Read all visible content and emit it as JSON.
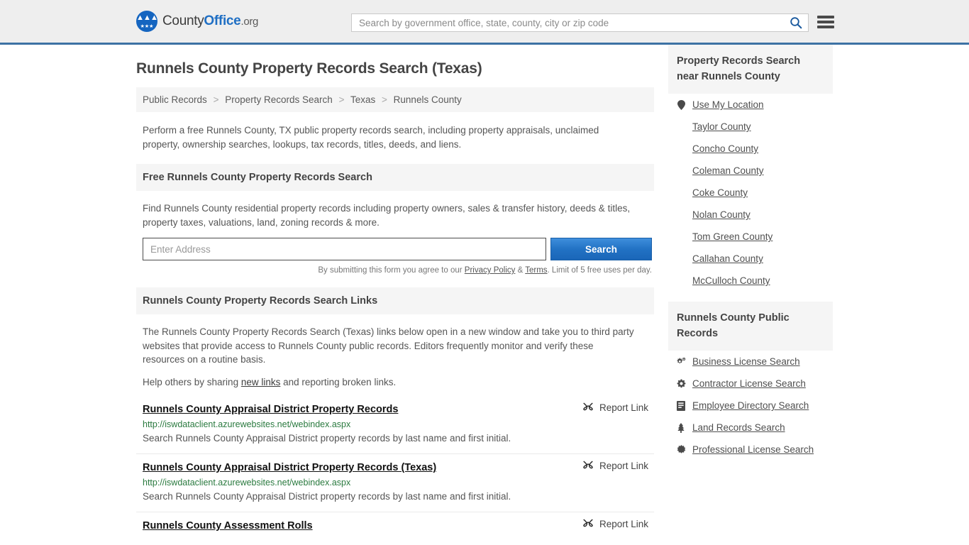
{
  "header": {
    "brand": {
      "part1": "County",
      "part2": "Office",
      "part3": ".org"
    },
    "search": {
      "placeholder": "Search by government office, state, county, city or zip code",
      "value": ""
    },
    "menu_label": "Menu"
  },
  "page_title": "Runnels County Property Records Search (Texas)",
  "breadcrumb": {
    "items": [
      "Public Records",
      "Property Records Search",
      "Texas",
      "Runnels County"
    ],
    "separator": ">"
  },
  "intro": "Perform a free Runnels County, TX public property records search, including property appraisals, unclaimed property, ownership searches, lookups, tax records, titles, deeds, and liens.",
  "free_search": {
    "heading": "Free Runnels County Property Records Search",
    "description": "Find Runnels County residential property records including property owners, sales & transfer history, deeds & titles, property taxes, valuations, land, zoning records & more.",
    "input_placeholder": "Enter Address",
    "input_value": "",
    "button_label": "Search",
    "note_prefix": "By submitting this form you agree to our ",
    "note_privacy": "Privacy Policy",
    "note_amp": " & ",
    "note_terms": "Terms",
    "note_suffix": ". Limit of 5 free uses per day."
  },
  "links_section": {
    "heading": "Runnels County Property Records Search Links",
    "paragraph1": "The Runnels County Property Records Search (Texas) links below open in a new window and take you to third party websites that provide access to Runnels County public records. Editors frequently monitor and verify these resources on a routine basis.",
    "paragraph2_prefix": "Help others by sharing ",
    "paragraph2_link": "new links",
    "paragraph2_suffix": " and reporting broken links.",
    "report_label": "Report Link",
    "report_icon": "chain-broken-icon",
    "items": [
      {
        "title": "Runnels County Appraisal District Property Records",
        "url": "http://iswdataclient.azurewebsites.net/webindex.aspx",
        "description": "Search Runnels County Appraisal District property records by last name and first initial."
      },
      {
        "title": "Runnels County Appraisal District Property Records (Texas)",
        "url": "http://iswdataclient.azurewebsites.net/webindex.aspx",
        "description": "Search Runnels County Appraisal District property records by last name and first initial."
      },
      {
        "title": "Runnels County Assessment Rolls",
        "url": "",
        "description": ""
      }
    ]
  },
  "sidebar": {
    "nearby": {
      "heading": "Property Records Search near Runnels County",
      "items": [
        {
          "label": "Use My Location",
          "icon": "map-pin-icon"
        },
        {
          "label": "Taylor County",
          "icon": ""
        },
        {
          "label": "Concho County",
          "icon": ""
        },
        {
          "label": "Coleman County",
          "icon": ""
        },
        {
          "label": "Coke County",
          "icon": ""
        },
        {
          "label": "Nolan County",
          "icon": ""
        },
        {
          "label": "Tom Green County",
          "icon": ""
        },
        {
          "label": "Callahan County",
          "icon": ""
        },
        {
          "label": "McCulloch County",
          "icon": ""
        }
      ]
    },
    "public_records": {
      "heading": "Runnels County Public Records",
      "items": [
        {
          "label": "Business License Search",
          "icon": "cogs-icon"
        },
        {
          "label": "Contractor License Search",
          "icon": "cog-icon"
        },
        {
          "label": "Employee Directory Search",
          "icon": "book-icon"
        },
        {
          "label": "Land Records Search",
          "icon": "tree-icon"
        },
        {
          "label": "Professional License Search",
          "icon": "certificate-icon"
        }
      ]
    }
  },
  "colors": {
    "brand_blue": "#1f6fc4",
    "header_rule": "#3d72a4",
    "panel_grey": "#f5f5f5",
    "url_green": "#2a7a3f",
    "button_blue": "#2272c4"
  }
}
